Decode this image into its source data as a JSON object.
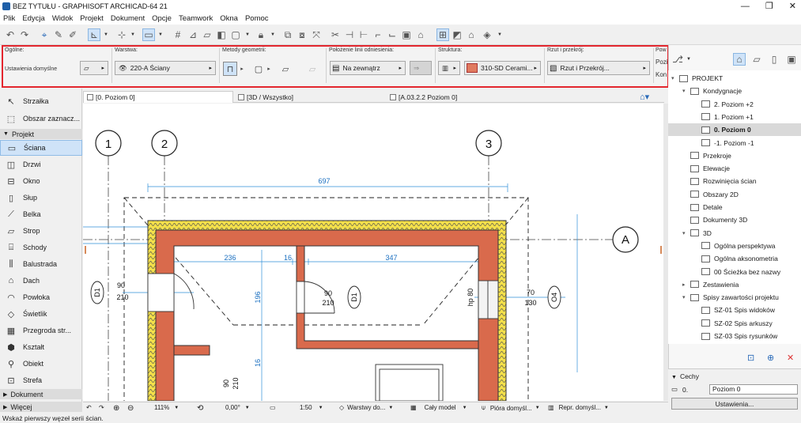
{
  "window": {
    "title": "BEZ TYTUŁU - GRAPHISOFT ARCHICAD-64 21",
    "minimize": "—",
    "restore": "❐",
    "close": "✕"
  },
  "menu": [
    "Plik",
    "Edycja",
    "Widok",
    "Projekt",
    "Dokument",
    "Opcje",
    "Teamwork",
    "Okna",
    "Pomoc"
  ],
  "infobox": {
    "general": {
      "label": "Ogólne:",
      "value": "Ustawienia domyślne"
    },
    "layer": {
      "label": "Warstwa:",
      "value": "220-A Ściany"
    },
    "geometry": {
      "label": "Metody geometrii:"
    },
    "refline": {
      "label": "Położenie linii odniesienia:",
      "value": "Na zewnątrz"
    },
    "structure": {
      "label": "Struktura:",
      "value": "310-SD Cerami..."
    },
    "plan": {
      "label": "Rzut i przekrój:",
      "value": "Rzut i Przekrój..."
    },
    "cut": {
      "label": "Pow",
      "lines": [
        "Pozi",
        "Kon"
      ]
    }
  },
  "toolbox": {
    "top": [
      {
        "label": "Strzałka",
        "icon": "arrow-icon"
      },
      {
        "label": "Obszar zaznacz...",
        "icon": "marquee-icon"
      }
    ],
    "group_projekt": "Projekt",
    "tools": [
      {
        "label": "Ściana",
        "icon": "wall-icon",
        "selected": true
      },
      {
        "label": "Drzwi",
        "icon": "door-icon"
      },
      {
        "label": "Okno",
        "icon": "window-icon"
      },
      {
        "label": "Słup",
        "icon": "column-icon"
      },
      {
        "label": "Belka",
        "icon": "beam-icon"
      },
      {
        "label": "Strop",
        "icon": "slab-icon"
      },
      {
        "label": "Schody",
        "icon": "stair-icon"
      },
      {
        "label": "Balustrada",
        "icon": "railing-icon"
      },
      {
        "label": "Dach",
        "icon": "roof-icon"
      },
      {
        "label": "Powłoka",
        "icon": "shell-icon"
      },
      {
        "label": "Świetlik",
        "icon": "skylight-icon"
      },
      {
        "label": "Przegroda str...",
        "icon": "curtain-wall-icon"
      },
      {
        "label": "Kształt",
        "icon": "morph-icon"
      },
      {
        "label": "Obiekt",
        "icon": "object-icon"
      },
      {
        "label": "Strefa",
        "icon": "zone-icon"
      }
    ],
    "group_dokument": "Dokument",
    "group_wiecej": "Więcej"
  },
  "tabs": [
    {
      "label": "[0. Poziom 0]",
      "active": true
    },
    {
      "label": "[3D / Wszystko]",
      "active": false
    },
    {
      "label": "[A.03.2.2 Poziom 0]",
      "active": false
    }
  ],
  "drawing": {
    "grid": [
      "1",
      "2",
      "3",
      "A"
    ],
    "dims": {
      "top": "697",
      "a": "236",
      "b": "16",
      "c": "347",
      "v1": "196",
      "v2": "16"
    },
    "door1": {
      "w": "90",
      "h": "210",
      "tag": "D1"
    },
    "door2": {
      "w": "90",
      "h": "210",
      "tag": "D1"
    },
    "door3": {
      "w": "90",
      "h": "210"
    },
    "win": {
      "w": "70",
      "h": "130",
      "tag": "O4",
      "sill": "hp 80"
    }
  },
  "status": {
    "zoom": "111%",
    "angle": "0,00°",
    "scale": "1:50",
    "layers": "Warstwy do...",
    "model": "Cały model",
    "pens": "Pióra domyśl...",
    "repr": "Repr. domyśl..."
  },
  "hint": "Wskaż pierwszy węzeł serii ścian.",
  "navigator": {
    "items": [
      {
        "label": "PROJEKT",
        "level": 0,
        "arrow": "▾"
      },
      {
        "label": "Kondygnacje",
        "level": 1,
        "arrow": "▾"
      },
      {
        "label": "2. Poziom +2",
        "level": 2,
        "arrow": ""
      },
      {
        "label": "1. Poziom +1",
        "level": 2,
        "arrow": ""
      },
      {
        "label": "0. Poziom 0",
        "level": 2,
        "arrow": "",
        "selected": true
      },
      {
        "label": "-1. Poziom -1",
        "level": 2,
        "arrow": ""
      },
      {
        "label": "Przekroje",
        "level": 1,
        "arrow": ""
      },
      {
        "label": "Elewacje",
        "level": 1,
        "arrow": ""
      },
      {
        "label": "Rozwinięcia ścian",
        "level": 1,
        "arrow": ""
      },
      {
        "label": "Obszary 2D",
        "level": 1,
        "arrow": ""
      },
      {
        "label": "Detale",
        "level": 1,
        "arrow": ""
      },
      {
        "label": "Dokumenty 3D",
        "level": 1,
        "arrow": ""
      },
      {
        "label": "3D",
        "level": 1,
        "arrow": "▾"
      },
      {
        "label": "Ogólna perspektywa",
        "level": 2,
        "arrow": ""
      },
      {
        "label": "Ogólna aksonometria",
        "level": 2,
        "arrow": ""
      },
      {
        "label": "00 Ścieżka bez nazwy",
        "level": 2,
        "arrow": ""
      },
      {
        "label": "Zestawienia",
        "level": 1,
        "arrow": "▸"
      },
      {
        "label": "Spisy zawartości projektu",
        "level": 1,
        "arrow": "▾"
      },
      {
        "label": "SZ-01 Spis widoków",
        "level": 2,
        "arrow": ""
      },
      {
        "label": "SZ-02 Spis arkuszy",
        "level": 2,
        "arrow": ""
      },
      {
        "label": "SZ-03 Spis rysunków",
        "level": 2,
        "arrow": ""
      }
    ]
  },
  "cechy": {
    "title": "Cechy",
    "id": "0.",
    "name": "Poziom 0",
    "button": "Ustawienia..."
  }
}
